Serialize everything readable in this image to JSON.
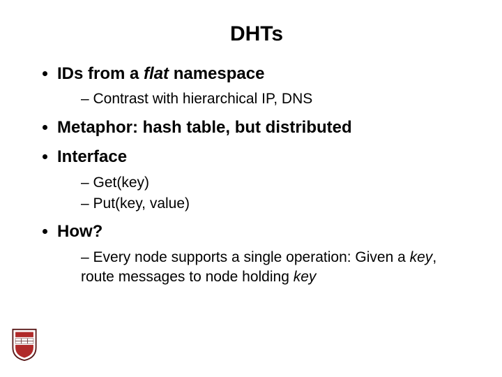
{
  "title": "DHTs",
  "bullets": {
    "b1": {
      "prefix": "IDs from a ",
      "em": "flat",
      "suffix": " namespace"
    },
    "b1_sub1": "Contrast with hierarchical IP, DNS",
    "b2": "Metaphor: hash table, but distributed",
    "b3": "Interface",
    "b3_sub1": "Get(key)",
    "b3_sub2": "Put(key, value)",
    "b4": "How?",
    "b4_sub1": {
      "prefix": "Every node supports a single operation: Given a ",
      "em": "key",
      "suffix": ", route messages to node holding "
    },
    "b4_sub1_line2": "key"
  }
}
